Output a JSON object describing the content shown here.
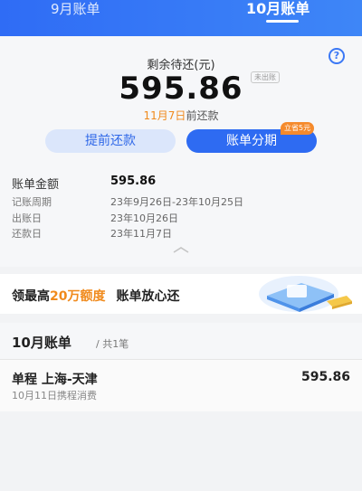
{
  "tabs": [
    {
      "label": "9月账单"
    },
    {
      "label": "10月账单"
    }
  ],
  "summary": {
    "remaining_label": "剩余待还(元)",
    "badge": "未出账",
    "amount": "595.86",
    "due_date": "11月7日",
    "due_suffix": "前还款"
  },
  "actions": {
    "repay_label": "提前还款",
    "installment_label": "账单分期",
    "save_badge": "立省5元"
  },
  "details": {
    "bill_amount": {
      "label": "账单金额",
      "value": "595.86"
    },
    "period": {
      "label": "记账周期",
      "value": "23年9月26日-23年10月25日"
    },
    "bill_day": {
      "label": "出账日",
      "value": "23年10月26日"
    },
    "due_day": {
      "label": "还款日",
      "value": "23年11月7日"
    }
  },
  "banner": {
    "prefix": "领最高",
    "highlight": "20万额度",
    "suffix": "账单放心还"
  },
  "list": {
    "title": "10月账单",
    "count": "/ 共1笔",
    "items": [
      {
        "title": "单程 上海-天津",
        "subtitle": "10月11日携程消费",
        "amount": "595.86"
      }
    ]
  },
  "colors": {
    "accent": "#2e6bf2",
    "highlight": "#f08a1c"
  }
}
